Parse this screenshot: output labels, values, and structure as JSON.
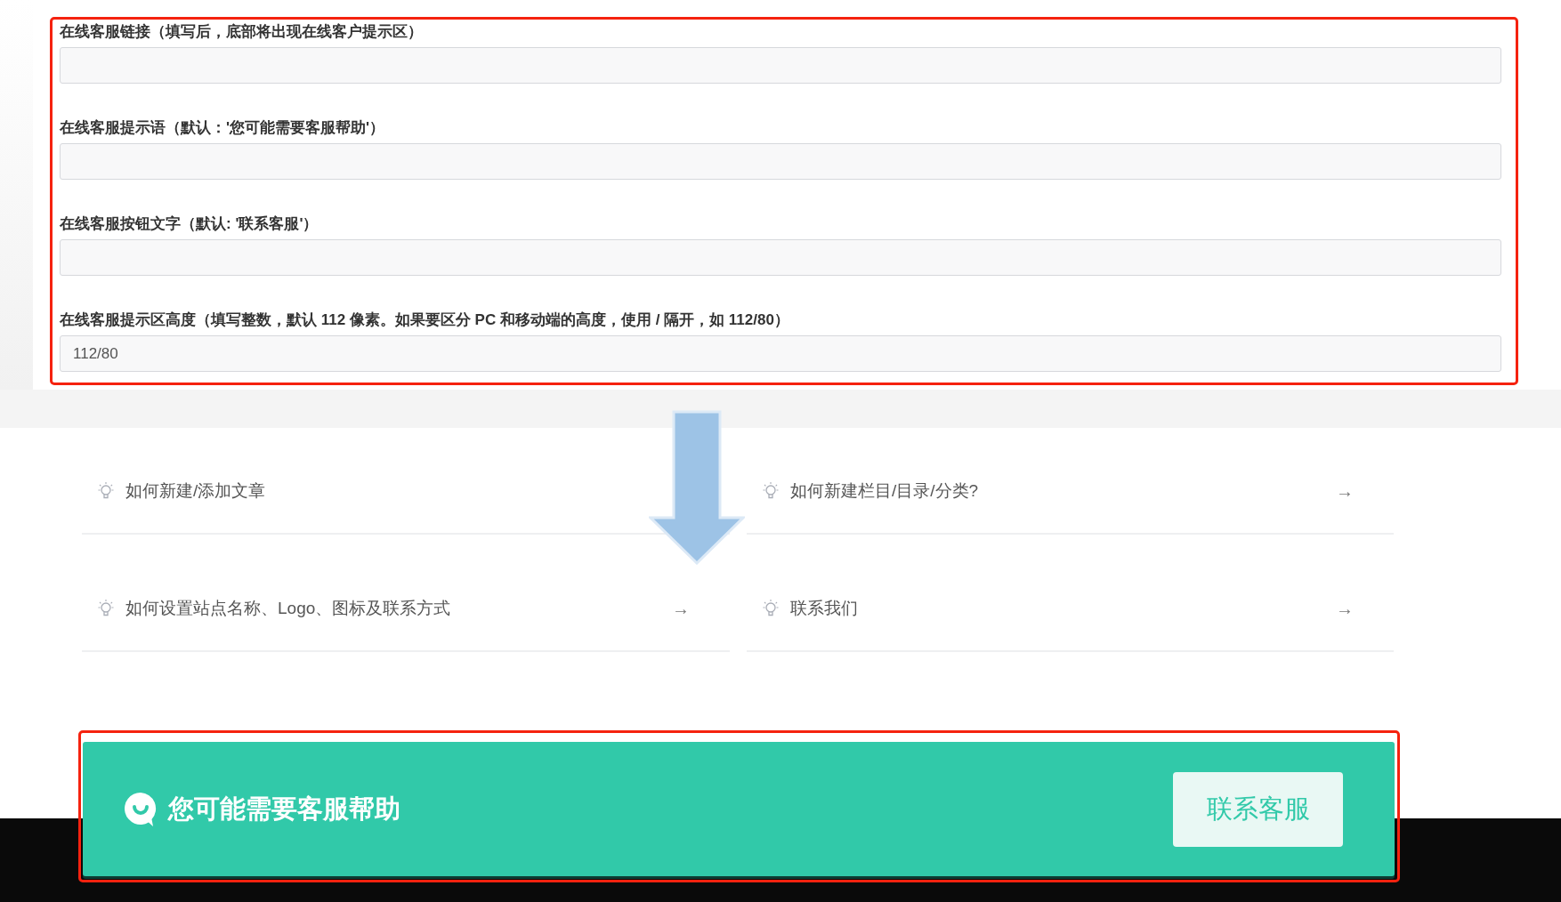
{
  "settings_fields": [
    {
      "label": "在线客服链接（填写后，底部将出现在线客户提示区）"
    },
    {
      "label": "在线客服提示语（默认：'您可能需要客服帮助'）"
    },
    {
      "label": "在线客服按钮文字（默认: '联系客服'）"
    },
    {
      "label": "在线客服提示区高度（填写整数，默认 112 像素。如果要区分 PC 和移动端的高度，使用 / 隔开，如 112/80）",
      "value": "112/80"
    }
  ],
  "help_links": [
    {
      "text": "如何新建/添加文章"
    },
    {
      "text": "如何新建栏目/目录/分类?",
      "arrow": "→"
    },
    {
      "text": "如何设置站点名称、Logo、图标及联系方式",
      "arrow": "→"
    },
    {
      "text": "联系我们",
      "arrow": "→"
    }
  ],
  "banner": {
    "message": "您可能需要客服帮助",
    "button": "联系客服"
  }
}
